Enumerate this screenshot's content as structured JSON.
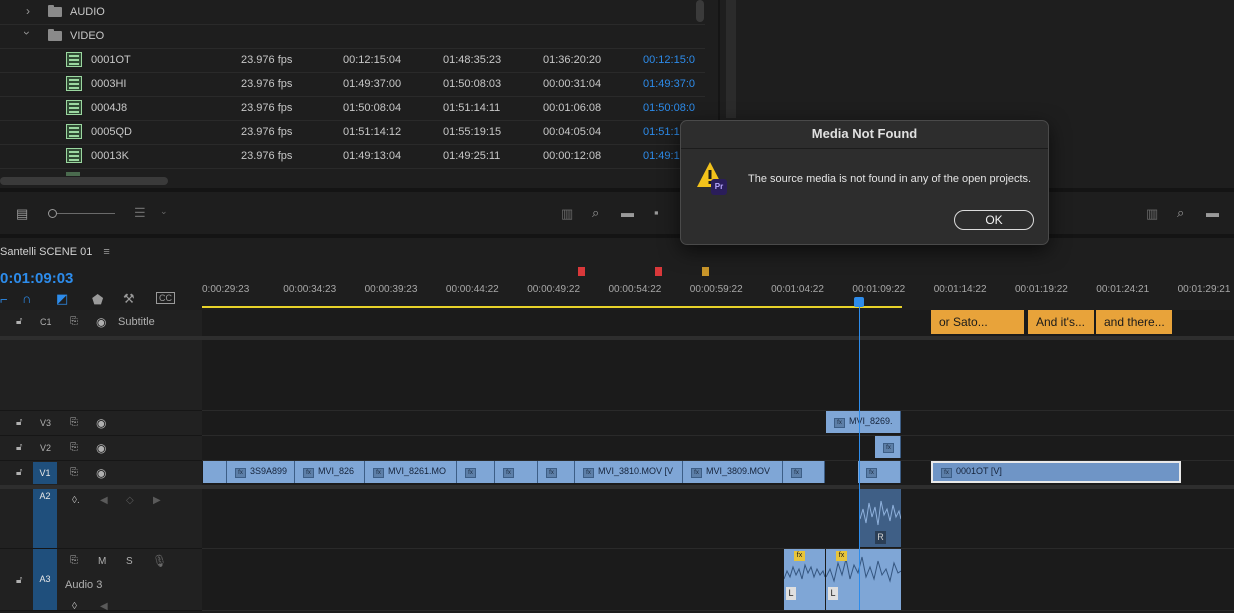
{
  "project": {
    "folders": [
      {
        "name": "AUDIO",
        "expanded": false
      },
      {
        "name": "VIDEO",
        "expanded": true
      }
    ],
    "items": [
      {
        "name": "0001OT",
        "fps": "23.976 fps",
        "start": "00:12:15:04",
        "end": "01:48:35:23",
        "duration": "01:36:20:20",
        "in": "00:12:15:0"
      },
      {
        "name": "0003HI",
        "fps": "23.976 fps",
        "start": "01:49:37:00",
        "end": "01:50:08:03",
        "duration": "00:00:31:04",
        "in": "01:49:37:0"
      },
      {
        "name": "0004J8",
        "fps": "23.976 fps",
        "start": "01:50:08:04",
        "end": "01:51:14:11",
        "duration": "00:01:06:08",
        "in": "01:50:08:0"
      },
      {
        "name": "0005QD",
        "fps": "23.976 fps",
        "start": "01:51:14:12",
        "end": "01:55:19:15",
        "duration": "00:04:05:04",
        "in": "01:51:1"
      },
      {
        "name": "00013K",
        "fps": "23.976 fps",
        "start": "01:49:13:04",
        "end": "01:49:25:11",
        "duration": "00:00:12:08",
        "in": "01:49:1"
      }
    ]
  },
  "timeline": {
    "sequence_title": "Santelli SCENE 01",
    "menu_icon": "≡",
    "timecode": "0:01:09:03",
    "ruler_ticks": [
      "0:00:29:23",
      "00:00:34:23",
      "00:00:39:23",
      "00:00:44:22",
      "00:00:49:22",
      "00:00:54:22",
      "00:00:59:22",
      "00:01:04:22",
      "00:01:09:22",
      "00:01:14:22",
      "00:01:19:22",
      "00:01:24:21",
      "00:01:29:21"
    ],
    "markers": [
      {
        "color": "#d9383a"
      },
      {
        "color": "#d9383a"
      },
      {
        "color": "#c9962a"
      }
    ],
    "tracks": {
      "c1": {
        "label": "C1",
        "name": "Subtitle"
      },
      "v3": {
        "label": "V3"
      },
      "v2": {
        "label": "V2"
      },
      "v1": {
        "label": "V1"
      },
      "a2": {
        "label": "A2"
      },
      "a3": {
        "label": "A3",
        "name": "Audio 3",
        "m": "M",
        "s": "S"
      }
    },
    "captions": [
      "or Sato...",
      "And it's...",
      "and there..."
    ],
    "v1_clips": [
      "",
      "3S9A899",
      "MVI_826",
      "MVI_8261.MO",
      "",
      "",
      "",
      "MVI_3810.MOV [V",
      "MVI_3809.MOV",
      "",
      ""
    ],
    "v1_offline_clip": "0001OT [V]",
    "v3_clip": "MVI_8269.",
    "audio_channel_labels": {
      "a2_right": "R",
      "a3_left_1": "L",
      "a3_left_2": "L"
    }
  },
  "dialog": {
    "title": "Media Not Found",
    "message": "The source media is not found in any of the open projects.",
    "ok_label": "OK",
    "app_badge": "Pr"
  },
  "colors": {
    "accent": "#2d8ceb",
    "caption": "#e8a33a",
    "clip": "#7fa6d6",
    "work_area": "#e8d32a"
  }
}
